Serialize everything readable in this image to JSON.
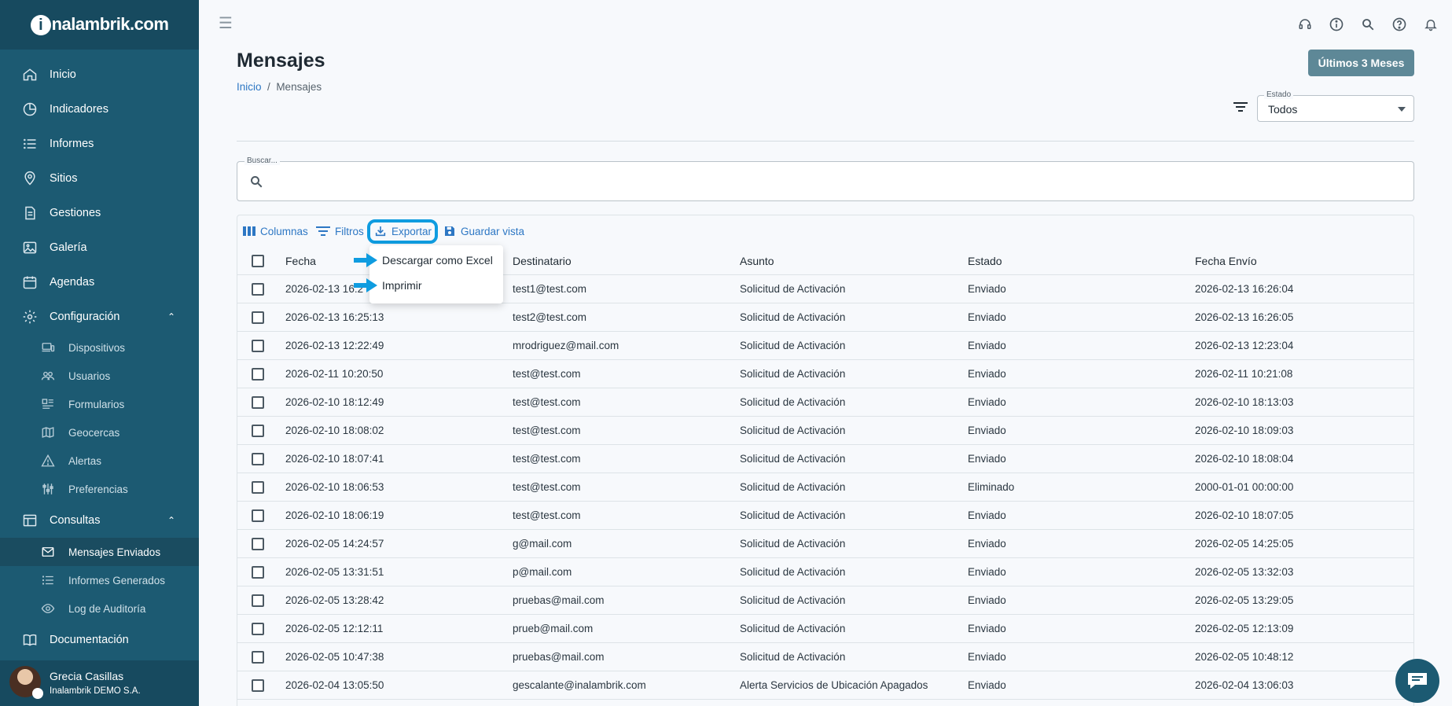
{
  "brand": {
    "logo_prefix": "i",
    "logo_rest": "nalambrik.com"
  },
  "sidebar": {
    "items": [
      {
        "label": "Inicio",
        "icon": "home-icon"
      },
      {
        "label": "Indicadores",
        "icon": "pie-chart-icon"
      },
      {
        "label": "Informes",
        "icon": "list-icon"
      },
      {
        "label": "Sitios",
        "icon": "location-icon"
      },
      {
        "label": "Gestiones",
        "icon": "document-icon"
      },
      {
        "label": "Galería",
        "icon": "image-icon"
      },
      {
        "label": "Agendas",
        "icon": "calendar-icon"
      },
      {
        "label": "Configuración",
        "icon": "gear-icon"
      }
    ],
    "config_sub": [
      {
        "label": "Dispositivos",
        "icon": "devices-icon"
      },
      {
        "label": "Usuarios",
        "icon": "users-icon"
      },
      {
        "label": "Formularios",
        "icon": "forms-icon"
      },
      {
        "label": "Geocercas",
        "icon": "map-icon"
      },
      {
        "label": "Alertas",
        "icon": "warning-icon"
      },
      {
        "label": "Preferencias",
        "icon": "sliders-icon"
      }
    ],
    "consultas": {
      "label": "Consultas",
      "icon": "table-icon"
    },
    "consultas_sub": [
      {
        "label": "Mensajes Enviados",
        "icon": "mail-icon",
        "active": true
      },
      {
        "label": "Informes Generados",
        "icon": "list-icon"
      },
      {
        "label": "Log de Auditoría",
        "icon": "eye-icon"
      }
    ],
    "docs": {
      "label": "Documentación",
      "icon": "book-icon"
    }
  },
  "user": {
    "name": "Grecia Casillas",
    "org": "Inalambrik DEMO S.A."
  },
  "header": {
    "title": "Mensajes",
    "breadcrumb_home": "Inicio",
    "breadcrumb_sep": "/",
    "breadcrumb_current": "Mensajes",
    "range_button": "Últimos 3 Meses",
    "estado_label": "Estado",
    "estado_value": "Todos"
  },
  "search": {
    "label": "Buscar...",
    "value": ""
  },
  "toolbar": {
    "columns": "Columnas",
    "filters": "Filtros",
    "export": "Exportar",
    "save_view": "Guardar vista"
  },
  "export_menu": {
    "excel": "Descargar como Excel",
    "print": "Imprimir"
  },
  "table": {
    "columns": [
      "Fecha",
      "Destinatario",
      "Asunto",
      "Estado",
      "Fecha Envío"
    ],
    "rows": [
      [
        "2026-02-13 16:2",
        "test1@test.com",
        "Solicitud de Activación",
        "Enviado",
        "2026-02-13 16:26:04"
      ],
      [
        "2026-02-13 16:25:13",
        "test2@test.com",
        "Solicitud de Activación",
        "Enviado",
        "2026-02-13 16:26:05"
      ],
      [
        "2026-02-13 12:22:49",
        "mrodriguez@mail.com",
        "Solicitud de Activación",
        "Enviado",
        "2026-02-13 12:23:04"
      ],
      [
        "2026-02-11 10:20:50",
        "test@test.com",
        "Solicitud de Activación",
        "Enviado",
        "2026-02-11 10:21:08"
      ],
      [
        "2026-02-10 18:12:49",
        "test@test.com",
        "Solicitud de Activación",
        "Enviado",
        "2026-02-10 18:13:03"
      ],
      [
        "2026-02-10 18:08:02",
        "test@test.com",
        "Solicitud de Activación",
        "Enviado",
        "2026-02-10 18:09:03"
      ],
      [
        "2026-02-10 18:07:41",
        "test@test.com",
        "Solicitud de Activación",
        "Enviado",
        "2026-02-10 18:08:04"
      ],
      [
        "2026-02-10 18:06:53",
        "test@test.com",
        "Solicitud de Activación",
        "Eliminado",
        "2000-01-01 00:00:00"
      ],
      [
        "2026-02-10 18:06:19",
        "test@test.com",
        "Solicitud de Activación",
        "Enviado",
        "2026-02-10 18:07:05"
      ],
      [
        "2026-02-05 14:24:57",
        "g@mail.com",
        "Solicitud de Activación",
        "Enviado",
        "2026-02-05 14:25:05"
      ],
      [
        "2026-02-05 13:31:51",
        "p@mail.com",
        "Solicitud de Activación",
        "Enviado",
        "2026-02-05 13:32:03"
      ],
      [
        "2026-02-05 13:28:42",
        "pruebas@mail.com",
        "Solicitud de Activación",
        "Enviado",
        "2026-02-05 13:29:05"
      ],
      [
        "2026-02-05 12:12:11",
        "prueb@mail.com",
        "Solicitud de Activación",
        "Enviado",
        "2026-02-05 12:13:09"
      ],
      [
        "2026-02-05 10:47:38",
        "pruebas@mail.com",
        "Solicitud de Activación",
        "Enviado",
        "2026-02-05 10:48:12"
      ],
      [
        "2026-02-04 13:05:50",
        "gescalante@inalambrik.com",
        "Alerta Servicios de Ubicación Apagados",
        "Enviado",
        "2026-02-04 13:06:03"
      ]
    ]
  },
  "colors": {
    "sidebar": "#1c5a72",
    "accent": "#2d77c4",
    "highlight": "#0f9ce0",
    "range_button": "#5e8897"
  }
}
